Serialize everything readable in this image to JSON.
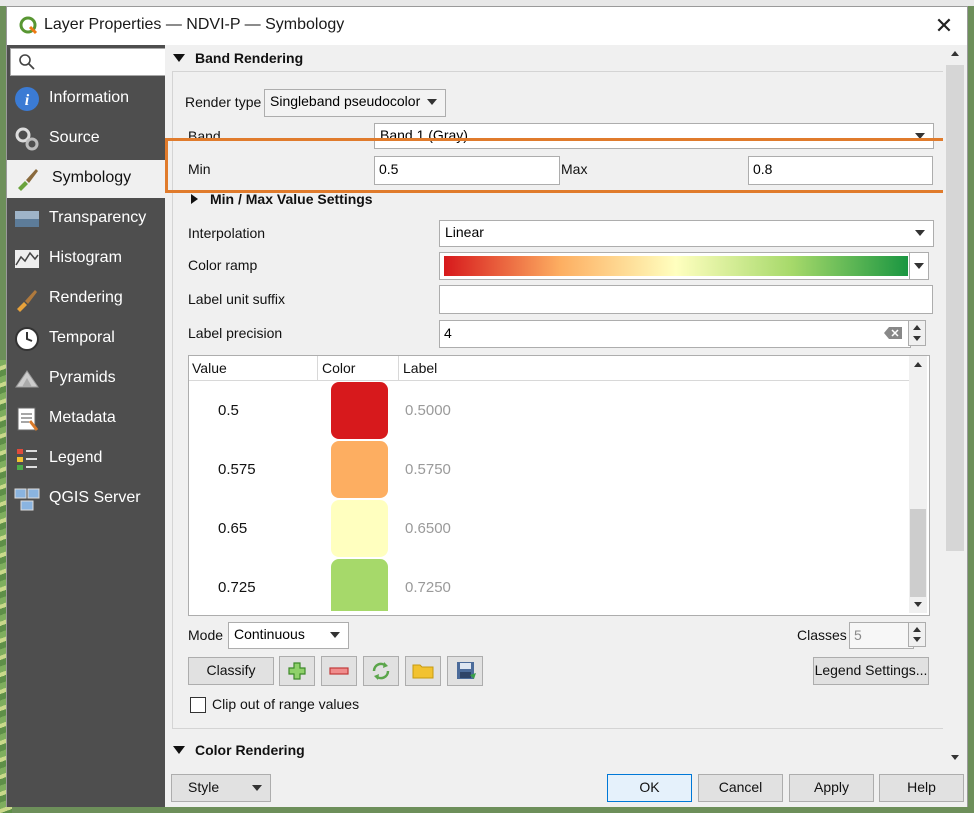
{
  "window": {
    "title": "Layer Properties — NDVI-P — Symbology"
  },
  "sidebar": {
    "search_placeholder": "",
    "items": [
      {
        "label": "Information",
        "icon": "info-icon"
      },
      {
        "label": "Source",
        "icon": "source-icon"
      },
      {
        "label": "Symbology",
        "icon": "symbology-brush-icon",
        "active": true
      },
      {
        "label": "Transparency",
        "icon": "transparency-icon"
      },
      {
        "label": "Histogram",
        "icon": "histogram-icon"
      },
      {
        "label": "Rendering",
        "icon": "rendering-brush-icon"
      },
      {
        "label": "Temporal",
        "icon": "clock-icon"
      },
      {
        "label": "Pyramids",
        "icon": "pyramids-icon"
      },
      {
        "label": "Metadata",
        "icon": "metadata-icon"
      },
      {
        "label": "Legend",
        "icon": "legend-icon"
      },
      {
        "label": "QGIS Server",
        "icon": "server-icon"
      }
    ]
  },
  "band_rendering": {
    "header": "Band Rendering",
    "render_type_label": "Render type",
    "render_type_value": "Singleband pseudocolor",
    "band_label": "Band",
    "band_value": "Band 1 (Gray)",
    "min_label": "Min",
    "min_value": "0.5",
    "max_label": "Max",
    "max_value": "0.8",
    "minmax_settings_label": "Min / Max Value Settings",
    "interpolation_label": "Interpolation",
    "interpolation_value": "Linear",
    "color_ramp_label": "Color ramp",
    "label_unit_suffix_label": "Label unit suffix",
    "label_unit_suffix_value": "",
    "label_precision_label": "Label precision",
    "label_precision_value": "4",
    "table": {
      "headers": {
        "value": "Value",
        "color": "Color",
        "label": "Label"
      },
      "rows": [
        {
          "value": "0.5",
          "color": "#d7191c",
          "label": "0.5000"
        },
        {
          "value": "0.575",
          "color": "#fdae61",
          "label": "0.5750"
        },
        {
          "value": "0.65",
          "color": "#ffffbf",
          "label": "0.6500"
        },
        {
          "value": "0.725",
          "color": "#a6d96a",
          "label": "0.7250"
        }
      ]
    },
    "mode_label": "Mode",
    "mode_value": "Continuous",
    "classes_label": "Classes",
    "classes_value": "5",
    "classify_label": "Classify",
    "legend_settings_label": "Legend Settings...",
    "clip_label": "Clip out of range values"
  },
  "color_rendering": {
    "header": "Color Rendering"
  },
  "footer": {
    "style_label": "Style",
    "ok_label": "OK",
    "cancel_label": "Cancel",
    "apply_label": "Apply",
    "help_label": "Help"
  },
  "colors": {
    "highlight": "#e07b2c",
    "sidebar_bg": "#4e4e4e"
  }
}
